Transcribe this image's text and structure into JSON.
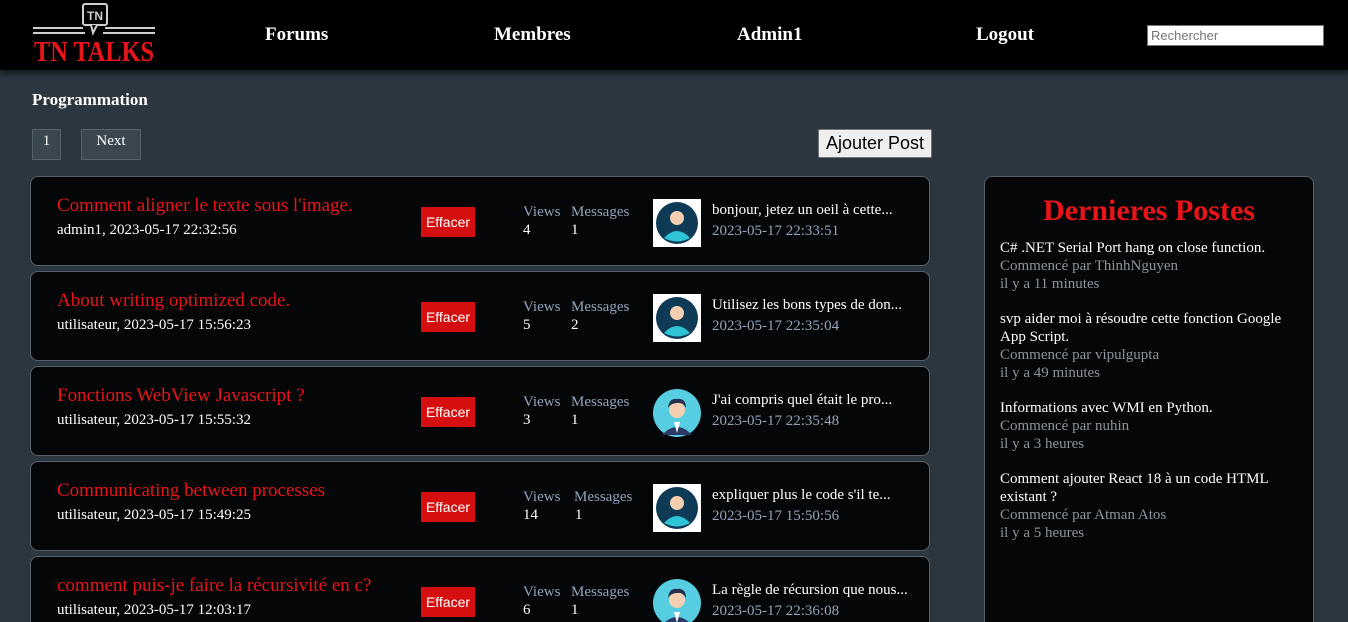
{
  "header": {
    "logo_badge": "TN",
    "logo_text": "TN TALKS",
    "nav": [
      "Forums",
      "Membres",
      "Admin1",
      "Logout"
    ],
    "search_placeholder": "Rechercher"
  },
  "section_title": "Programmation",
  "pagination": {
    "page": "1",
    "next": "Next"
  },
  "add_post_label": "Ajouter Post",
  "stat_labels": {
    "views": "Views",
    "messages": "Messages"
  },
  "delete_label": "Effacer",
  "posts": [
    {
      "title": "Comment aligner le texte sous l'image.",
      "meta": "admin1, 2023-05-17 22:32:56",
      "views": "4",
      "messages": "1",
      "last_message": "bonjour, jetez un oeil à cette...",
      "last_date": "2023-05-17 22:33:51",
      "avatar": "user-avatar-icon"
    },
    {
      "title": "About writing optimized code.",
      "meta": "utilisateur, 2023-05-17 15:56:23",
      "views": "5",
      "messages": "2",
      "last_message": "Utilisez les bons types de don...",
      "last_date": "2023-05-17 22:35:04",
      "avatar": "user-avatar-icon"
    },
    {
      "title": "Fonctions WebView Javascript ?",
      "meta": "utilisateur, 2023-05-17 15:55:32",
      "views": "3",
      "messages": "1",
      "last_message": "J'ai compris quel était le pro...",
      "last_date": "2023-05-17 22:35:48",
      "avatar": "man-avatar-icon"
    },
    {
      "title": "Communicating between processes",
      "meta": "utilisateur, 2023-05-17 15:49:25",
      "views": "14",
      "messages": "1",
      "last_message": "expliquer plus le code s'il te...",
      "last_date": "2023-05-17 15:50:56",
      "avatar": "user-avatar-icon"
    },
    {
      "title": "comment puis-je faire la récursivité en c?",
      "meta": "utilisateur, 2023-05-17 12:03:17",
      "views": "6",
      "messages": "1",
      "last_message": "La règle de récursion que nous...",
      "last_date": "2023-05-17 22:36:08",
      "avatar": "man-avatar-icon"
    }
  ],
  "sidebar": {
    "title": "Dernieres Postes",
    "items": [
      {
        "title": "C# .NET Serial Port hang on close function.",
        "author": "Commencé par ThinhNguyen",
        "time": "il y a 11 minutes"
      },
      {
        "title": "svp aider moi à résoudre cette fonction Google App Script.",
        "author": "Commencé par vipulgupta",
        "time": "il y a 49 minutes"
      },
      {
        "title": "Informations avec WMI en Python.",
        "author": "Commencé par nuhin",
        "time": "il y a 3 heures"
      },
      {
        "title": "Comment ajouter React 18 à un code HTML existant ?",
        "author": "Commencé par Atman Atos",
        "time": "il y a 5 heures"
      }
    ]
  },
  "colors": {
    "accent_red": "#e8141a",
    "button_red": "#d50f0f",
    "page_bg": "#2b363f",
    "muted_blue": "#93a5bb"
  }
}
